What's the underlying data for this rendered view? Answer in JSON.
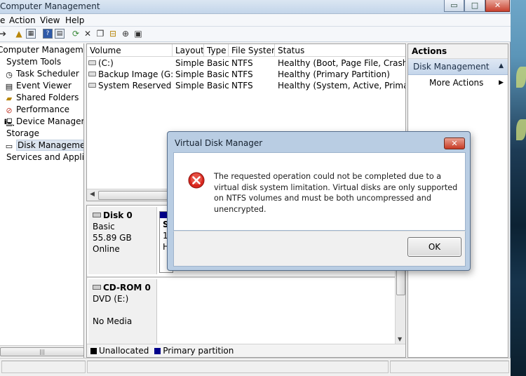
{
  "window": {
    "title": "Computer Management",
    "buttons": {
      "minimize": "▭",
      "maximize": "□",
      "close": "✕"
    }
  },
  "menu": {
    "action": "Action",
    "view": "View",
    "help": "Help"
  },
  "tree": {
    "root": "Computer Management",
    "system_tools": "System Tools",
    "task_scheduler": "Task Scheduler",
    "event_viewer": "Event Viewer",
    "shared_folders": "Shared Folders",
    "performance": "Performance",
    "device_manager": "Device Manager",
    "storage": "Storage",
    "disk_management": "Disk Management",
    "services": "Services and Applicat"
  },
  "volume_list": {
    "columns": [
      "Volume",
      "Layout",
      "Type",
      "File System",
      "Status"
    ],
    "rows": [
      {
        "volume": "(C:)",
        "layout": "Simple",
        "type": "Basic",
        "fs": "NTFS",
        "status": "Healthy (Boot, Page File, Crash Dum"
      },
      {
        "volume": "Backup Image (G:)",
        "layout": "Simple",
        "type": "Basic",
        "fs": "NTFS",
        "status": "Healthy (Primary Partition)"
      },
      {
        "volume": "System Reserved (F:)",
        "layout": "Simple",
        "type": "Basic",
        "fs": "NTFS",
        "status": "Healthy (System, Active, Primary Par"
      }
    ]
  },
  "disks": {
    "disk0": {
      "name": "Disk 0",
      "kind": "Basic",
      "size": "55.89 GB",
      "state": "Online",
      "part_line1": "S",
      "part_line2": "1",
      "part_line3": "H"
    },
    "cdrom0": {
      "name": "CD-ROM 0",
      "drive": "DVD (E:)",
      "media": "No Media"
    }
  },
  "legend": {
    "unallocated": "Unallocated",
    "primary": "Primary partition",
    "unallocated_color": "#000000",
    "primary_color": "#00008b"
  },
  "actions": {
    "header": "Actions",
    "section": "Disk Management",
    "more": "More Actions"
  },
  "dialog": {
    "title": "Virtual Disk Manager",
    "close": "✕",
    "message": "The requested operation could not be completed due to a virtual disk system limitation.  Virtual disks are only supported on NTFS volumes and must be both uncompressed and unencrypted.",
    "ok": "OK",
    "icon": "error-icon"
  }
}
